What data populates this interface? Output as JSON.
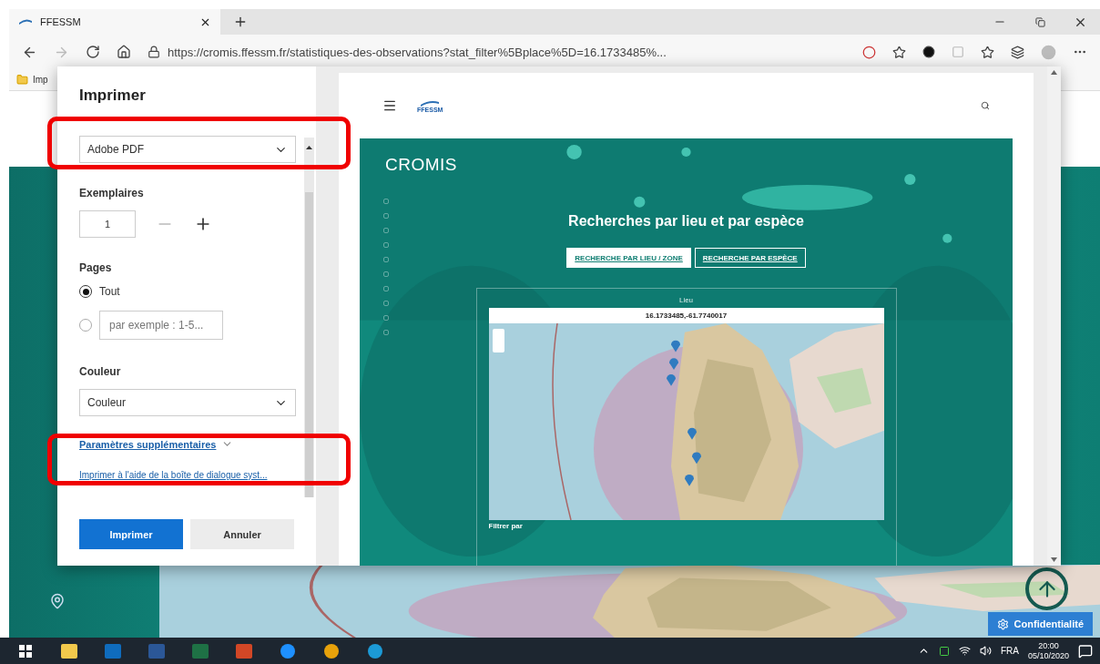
{
  "browser_tab": {
    "title": "FFESSM"
  },
  "address_bar": {
    "url": "https://cromis.ffessm.fr/statistiques-des-observations?stat_filter%5Bplace%5D=16.1733485%..."
  },
  "bookmarks": [
    {
      "label": "Imp"
    }
  ],
  "print_dialog": {
    "title": "Imprimer",
    "printer": "Adobe PDF",
    "copies_label": "Exemplaires",
    "copies": "1",
    "pages_label": "Pages",
    "page_options": [
      {
        "kind": "label",
        "label": "Tout",
        "selected": true
      },
      {
        "kind": "range",
        "placeholder": "par exemple : 1-5...",
        "selected": false
      }
    ],
    "color_label": "Couleur",
    "color_mode": "Couleur",
    "more_settings": "Paramètres supplémentaires",
    "system_dialog_link": "Imprimer à l'aide de la boîte de dialogue syst...",
    "buttons": [
      {
        "label": "Imprimer",
        "kind": "primary"
      },
      {
        "label": "Annuler",
        "kind": "secondary"
      }
    ]
  },
  "preview": {
    "logo": "FFESSM",
    "brand": "CROMIS",
    "heading": "Recherches par lieu et par espèce",
    "search_tabs": [
      {
        "label": "RECHERCHE PAR LIEU / ZONE",
        "selected": true
      },
      {
        "label": "RECHERCHE PAR ESPÈCE",
        "selected": false
      }
    ],
    "map_label": "Lieu",
    "coordinates": "16.1733485,-61.7740017",
    "filter_title": "Filtrer par"
  },
  "page": {
    "privacy_button": "Confidentialité"
  },
  "taskbar": {
    "language": "FRA",
    "time": "20:00",
    "date": "05/10/2020"
  }
}
